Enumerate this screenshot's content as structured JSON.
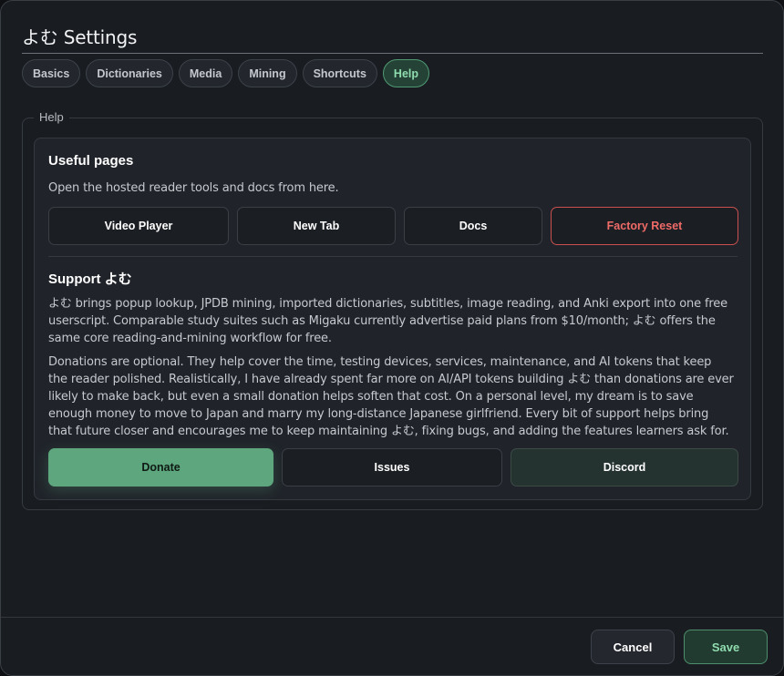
{
  "dialog": {
    "title": "よむ Settings"
  },
  "tabs": [
    {
      "label": "Basics"
    },
    {
      "label": "Dictionaries"
    },
    {
      "label": "Media"
    },
    {
      "label": "Mining"
    },
    {
      "label": "Shortcuts"
    },
    {
      "label": "Help",
      "active": true
    }
  ],
  "help": {
    "legend": "Help",
    "useful": {
      "heading": "Useful pages",
      "description": "Open the hosted reader tools and docs from here.",
      "buttons": {
        "video_player": "Video Player",
        "new_tab": "New Tab",
        "docs": "Docs",
        "factory_reset": "Factory Reset"
      }
    },
    "support": {
      "heading": "Support よむ",
      "paragraph1": "よむ brings popup lookup, JPDB mining, imported dictionaries, subtitles, image reading, and Anki export into one free userscript. Comparable study suites such as Migaku currently advertise paid plans from $10/month; よむ offers the same core reading-and-mining workflow for free.",
      "paragraph2": "Donations are optional. They help cover the time, testing devices, services, maintenance, and AI tokens that keep the reader polished. Realistically, I have already spent far more on AI/API tokens building よむ than donations are ever likely to make back, but even a small donation helps soften that cost. On a personal level, my dream is to save enough money to move to Japan and marry my long-distance Japanese girlfriend. Every bit of support helps bring that future closer and encourages me to keep maintaining よむ, fixing bugs, and adding the features learners ask for.",
      "buttons": {
        "donate": "Donate",
        "issues": "Issues",
        "discord": "Discord"
      }
    }
  },
  "footer": {
    "cancel": "Cancel",
    "save": "Save"
  },
  "colors": {
    "accent_green": "#5ea67e",
    "danger_red": "#ef6b68",
    "background": "#191c21"
  }
}
